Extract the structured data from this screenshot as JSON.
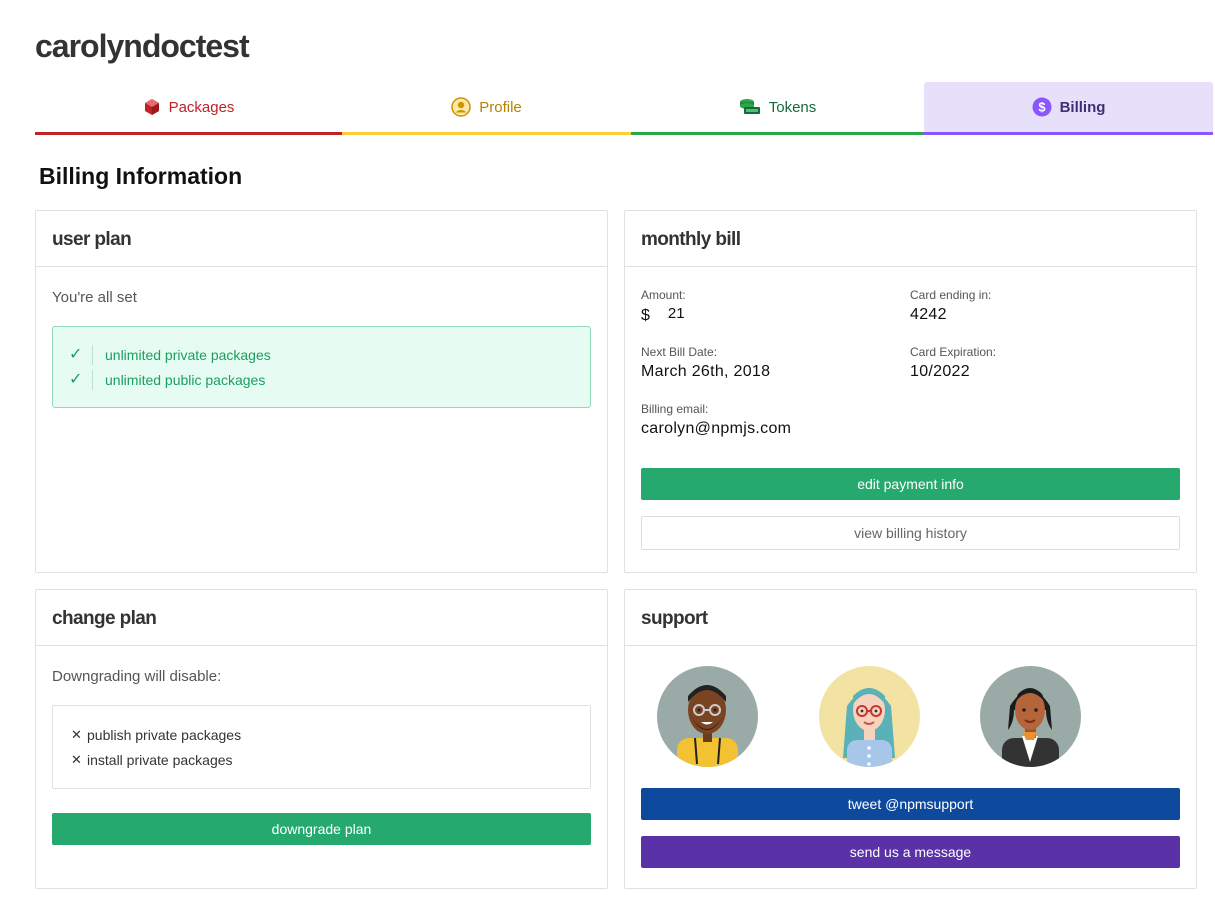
{
  "user": {
    "name": "carolyndoctest"
  },
  "tabs": [
    {
      "label": "Packages",
      "icon": "package-icon"
    },
    {
      "label": "Profile",
      "icon": "profile-icon"
    },
    {
      "label": "Tokens",
      "icon": "tokens-icon"
    },
    {
      "label": "Billing",
      "icon": "dollar-icon",
      "active": true
    }
  ],
  "page": {
    "title": "Billing Information"
  },
  "user_plan": {
    "title": "user plan",
    "status": "You're all set",
    "features": [
      "unlimited private packages",
      "unlimited public packages"
    ]
  },
  "monthly_bill": {
    "title": "monthly bill",
    "amount_label": "Amount:",
    "currency": "$",
    "amount": "21",
    "card_label": "Card ending in:",
    "card": "4242",
    "next_bill_label": "Next Bill Date:",
    "next_bill": "March 26th, 2018",
    "expiration_label": "Card Expiration:",
    "expiration": "10/2022",
    "email_label": "Billing email:",
    "email": "carolyn@npmjs.com",
    "edit_button": "edit payment info",
    "history_button": "view billing history"
  },
  "change_plan": {
    "title": "change plan",
    "description": "Downgrading will disable:",
    "items": [
      "publish private packages",
      "install private packages"
    ],
    "button": "downgrade plan"
  },
  "support": {
    "title": "support",
    "tweet_button": "tweet @npmsupport",
    "message_button": "send us a message"
  },
  "colors": {
    "packages": "#c12127",
    "profile": "#ffcd3a",
    "tokens": "#2aa847",
    "billing": "#8956ff",
    "green_button": "#25a96e",
    "tweet_button": "#0d4a9e",
    "message_button": "#5a31a6"
  }
}
